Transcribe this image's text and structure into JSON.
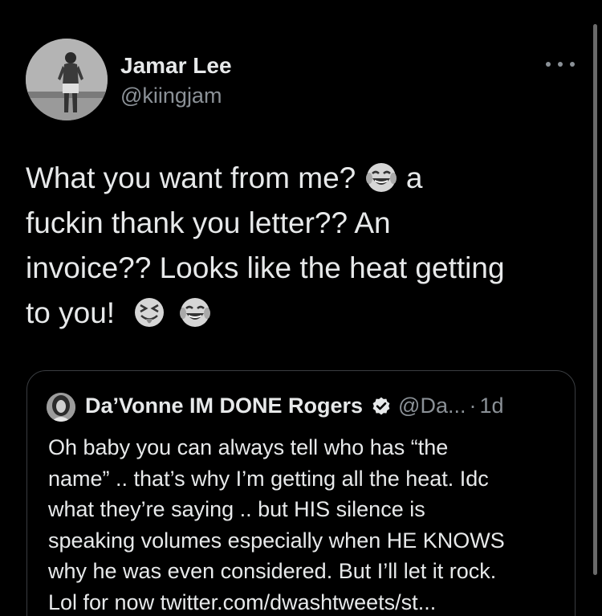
{
  "tweet": {
    "author_name": "Jamar Lee",
    "author_handle": "@kiingjam",
    "more_icon": "more-horizontal-icon",
    "text_lines": [
      {
        "text": "What you want from me?",
        "emoji_after": "face-with-tears-of-joy",
        "text_after": " a"
      },
      {
        "text": "fuckin thank you letter?? An"
      },
      {
        "text": "invoice?? Looks like the heat getting"
      },
      {
        "text": "to you!",
        "emoji_after": "squinting-face-with-tongue",
        "emoji_after_2": "face-with-tears-of-joy"
      }
    ]
  },
  "quote": {
    "author_name": "Da’Vonne IM DONE Rogers",
    "verified_icon": "verified-badge-icon",
    "author_handle": "@Da...",
    "separator": "·",
    "time": "1d",
    "text_lines": [
      "Oh baby you can always tell who has “the",
      "name” .. that’s why I’m getting all the heat. Idc",
      "what they’re saying .. but HIS silence is",
      "speaking volumes especially when HE KNOWS",
      "why he was even considered. But I’ll let it rock.",
      "Lol for now twitter.com/dwashtweets/st..."
    ]
  },
  "colors": {
    "background": "#000000",
    "primary_text": "#e7e9ea",
    "secondary_text": "#8b9197",
    "border": "#3a3d41"
  }
}
